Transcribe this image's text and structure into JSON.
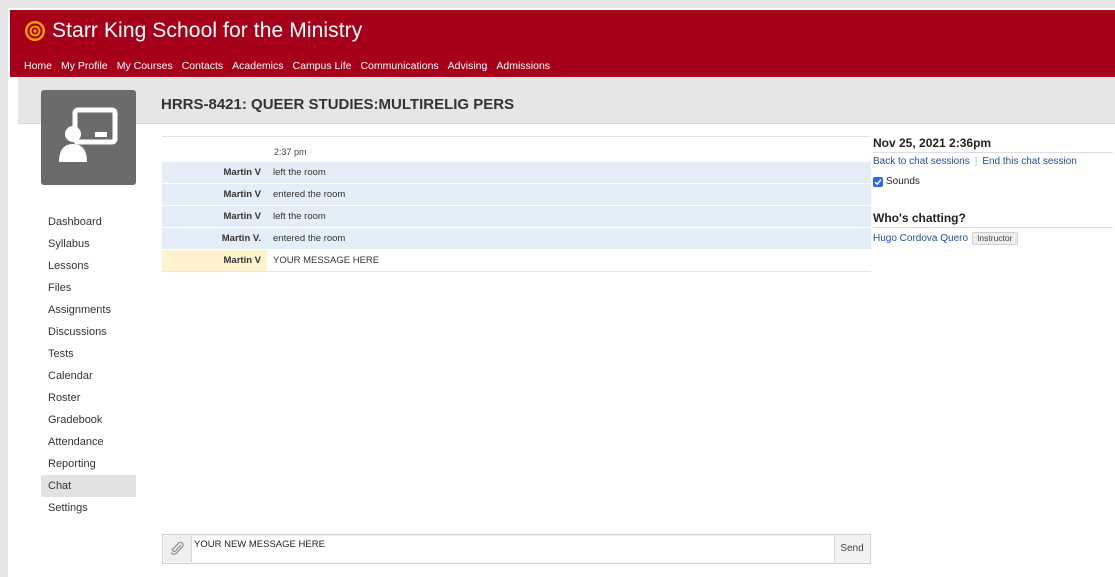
{
  "header": {
    "school_name": "Starr King School for the Ministry",
    "nav": [
      "Home",
      "My Profile",
      "My Courses",
      "Contacts",
      "Academics",
      "Campus Life",
      "Communications",
      "Advising",
      "Admissions"
    ]
  },
  "course": {
    "title": "HRRS-8421: QUEER STUDIES:MULTIRELIG PERS"
  },
  "sidebar": {
    "items": [
      "Dashboard",
      "Syllabus",
      "Lessons",
      "Files",
      "Assignments",
      "Discussions",
      "Tests",
      "Calendar",
      "Roster",
      "Gradebook",
      "Attendance",
      "Reporting",
      "Chat",
      "Settings"
    ],
    "active": "Chat"
  },
  "chat": {
    "time": "2:37 pm",
    "messages": [
      {
        "who": "Martin V",
        "text": "left the room"
      },
      {
        "who": "Martin V",
        "text": "entered the room"
      },
      {
        "who": "Martin V",
        "text": "left the room"
      },
      {
        "who": "Martin V.",
        "text": "entered the room"
      },
      {
        "who": "Martin V",
        "text": "YOUR MESSAGE HERE"
      }
    ]
  },
  "right_panel": {
    "datetime": "Nov 25, 2021 2:36pm",
    "back_link": "Back to chat sessions",
    "end_link": "End this chat session",
    "sounds_label": "Sounds",
    "sounds_checked": true,
    "participants_heading": "Who's chatting?",
    "participant_name": "Hugo Cordova Quero",
    "participant_role": "Instructor"
  },
  "composer": {
    "value": "YOUR NEW MESSAGE HERE",
    "send_label": "Send"
  },
  "colors": {
    "brand": "#a7001b",
    "link": "#1f4ea8",
    "system_row": "#e4eef9",
    "own_row": "#fdf3cf"
  }
}
